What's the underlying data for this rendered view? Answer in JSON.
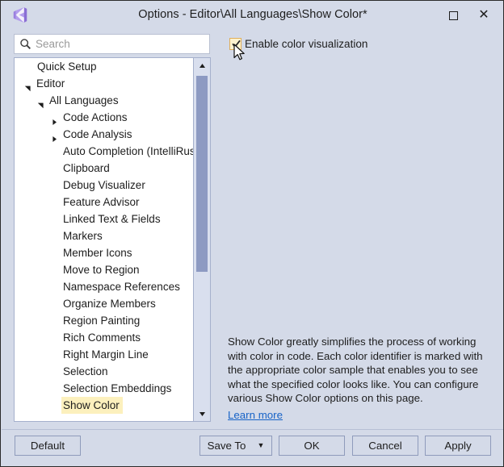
{
  "window": {
    "title": "Options - Editor\\All Languages\\Show Color*",
    "logo_icon": "visual-studio-icon",
    "maximize_icon": "maximize-icon",
    "close_icon": "close-icon"
  },
  "search": {
    "placeholder": "Search",
    "value": "",
    "icon": "search-icon"
  },
  "options": {
    "enable_color_visualization": {
      "label": "Enable color visualization",
      "checked": true
    }
  },
  "tree": {
    "items": [
      {
        "label": "Quick Setup",
        "level": 0,
        "expander": "none",
        "selected": false
      },
      {
        "label": "Editor",
        "level": 1,
        "expander": "expanded",
        "selected": false
      },
      {
        "label": "All Languages",
        "level": 2,
        "expander": "expanded",
        "selected": false
      },
      {
        "label": "Code Actions",
        "level": 3,
        "expander": "collapsed",
        "selected": false
      },
      {
        "label": "Code Analysis",
        "level": 3,
        "expander": "collapsed",
        "selected": false
      },
      {
        "label": "Auto Completion (IntelliRush)",
        "level": 3,
        "expander": "none",
        "selected": false
      },
      {
        "label": "Clipboard",
        "level": 3,
        "expander": "none",
        "selected": false
      },
      {
        "label": "Debug Visualizer",
        "level": 3,
        "expander": "none",
        "selected": false
      },
      {
        "label": "Feature Advisor",
        "level": 3,
        "expander": "none",
        "selected": false
      },
      {
        "label": "Linked Text & Fields",
        "level": 3,
        "expander": "none",
        "selected": false
      },
      {
        "label": "Markers",
        "level": 3,
        "expander": "none",
        "selected": false
      },
      {
        "label": "Member Icons",
        "level": 3,
        "expander": "none",
        "selected": false
      },
      {
        "label": "Move to Region",
        "level": 3,
        "expander": "none",
        "selected": false
      },
      {
        "label": "Namespace References",
        "level": 3,
        "expander": "none",
        "selected": false
      },
      {
        "label": "Organize Members",
        "level": 3,
        "expander": "none",
        "selected": false
      },
      {
        "label": "Region Painting",
        "level": 3,
        "expander": "none",
        "selected": false
      },
      {
        "label": "Rich Comments",
        "level": 3,
        "expander": "none",
        "selected": false
      },
      {
        "label": "Right Margin Line",
        "level": 3,
        "expander": "none",
        "selected": false
      },
      {
        "label": "Selection",
        "level": 3,
        "expander": "none",
        "selected": false
      },
      {
        "label": "Selection Embeddings",
        "level": 3,
        "expander": "none",
        "selected": false
      },
      {
        "label": "Show Color",
        "level": 3,
        "expander": "none",
        "selected": true
      }
    ],
    "selection_highlight_color": "#fcf0bd"
  },
  "scrollbar": {
    "up_icon": "scroll-up-icon",
    "down_icon": "scroll-down-icon"
  },
  "description": {
    "text": "Show Color greatly simplifies the process of working with color in code. Each color identifier is marked with the appropriate color sample that enables you to see what the specified color looks like. You can configure various Show Color options on this page.",
    "link_label": "Learn more",
    "link_color": "#1763c7"
  },
  "footer": {
    "default_label": "Default",
    "save_to_label": "Save To",
    "save_to_caret": "▼",
    "ok_label": "OK",
    "cancel_label": "Cancel",
    "apply_label": "Apply"
  },
  "theme": {
    "dialog_background": "#d4dae8",
    "panel_background": "#ffffff",
    "checkbox_fill": "#fdf3cf",
    "checkbox_border": "#e0ae5a",
    "scrollbar_thumb": "#8d9ac2"
  }
}
